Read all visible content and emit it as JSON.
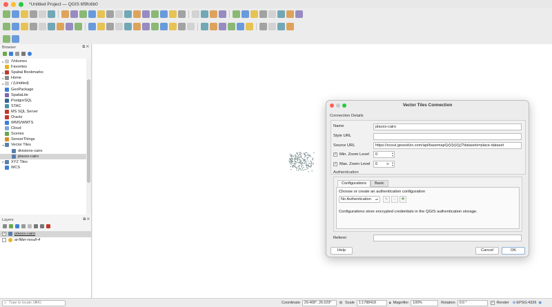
{
  "window": {
    "title": "*Untitled Project — QGIS 6f9fc6b0"
  },
  "toolbar_row1": [
    "new-project",
    "open-project",
    "save-project",
    "save-as",
    "print-layout",
    "layout-manager",
    "sep",
    "pan",
    "pan-to-selection",
    "zoom-in",
    "zoom-out",
    "zoom-full",
    "zoom-layer",
    "zoom-selection",
    "zoom-last",
    "zoom-next",
    "zoom-native",
    "new-map-view",
    "new-3d-view",
    "temporal",
    "refresh",
    "sep",
    "identify",
    "select",
    "deselect",
    "measure",
    "sep",
    "info",
    "attribute-table",
    "field-calc",
    "statistics",
    "toolbox",
    "show-tips",
    "annotation",
    "map-tips"
  ],
  "toolbar_row2": [
    "add-vector",
    "add-raster",
    "add-mesh",
    "add-csv",
    "add-spatialite",
    "add-postgis",
    "add-wms",
    "add-wfs",
    "add-vector-tile",
    "sep",
    "digitize",
    "edit",
    "save-edits",
    "add-feature",
    "move-feature",
    "vertex-tool",
    "delete",
    "cut",
    "copy",
    "paste",
    "undo",
    "redo",
    "sep",
    "label",
    "label-pin",
    "label-show",
    "label-move",
    "label-rotate",
    "label-change",
    "sep",
    "plugin-a",
    "plugin-b",
    "plugin-c",
    "python"
  ],
  "toolbar_row3": [
    "plugin-manager",
    "metasearch"
  ],
  "browser": {
    "title": "Browser",
    "items": [
      {
        "label": "/Volumes",
        "icon": "folder-icon",
        "arrow": "▸",
        "indent": 0
      },
      {
        "label": "Favorites",
        "icon": "star-icon",
        "arrow": "",
        "indent": 0
      },
      {
        "label": "Spatial Bookmarks",
        "icon": "bookmark-icon",
        "arrow": "▸",
        "indent": 0
      },
      {
        "label": "Home",
        "icon": "home-icon",
        "arrow": "▸",
        "indent": 0
      },
      {
        "label": "/ (Untitled)",
        "icon": "folder-icon",
        "arrow": "▸",
        "indent": 0
      },
      {
        "label": "GeoPackage",
        "icon": "geopackage-icon",
        "arrow": "",
        "indent": 0
      },
      {
        "label": "SpatiaLite",
        "icon": "spatialite-icon",
        "arrow": "",
        "indent": 0
      },
      {
        "label": "PostgreSQL",
        "icon": "postgresql-icon",
        "arrow": "",
        "indent": 0
      },
      {
        "label": "STAC",
        "icon": "stac-icon",
        "arrow": "",
        "indent": 0
      },
      {
        "label": "MS SQL Server",
        "icon": "mssql-icon",
        "arrow": "",
        "indent": 0
      },
      {
        "label": "Oracle",
        "icon": "oracle-icon",
        "arrow": "",
        "indent": 0
      },
      {
        "label": "WMS/WMTS",
        "icon": "globe-icon",
        "arrow": "",
        "indent": 0
      },
      {
        "label": "Cloud",
        "icon": "cloud-icon",
        "arrow": "",
        "indent": 0
      },
      {
        "label": "Scenes",
        "icon": "scenes-icon",
        "arrow": "",
        "indent": 0
      },
      {
        "label": "SensorThings",
        "icon": "sensor-icon",
        "arrow": "",
        "indent": 0
      },
      {
        "label": "Vector Tiles",
        "icon": "vector-tiles-icon",
        "arrow": "▾",
        "indent": 0
      },
      {
        "label": "divisions-cairo",
        "icon": "vector-tiles-icon",
        "arrow": "",
        "indent": 1
      },
      {
        "label": "places-cairo",
        "icon": "vector-tiles-icon",
        "arrow": "",
        "indent": 1,
        "selected": true
      },
      {
        "label": "XYZ Tiles",
        "icon": "xyz-icon",
        "arrow": "▸",
        "indent": 0
      },
      {
        "label": "WCS",
        "icon": "globe-icon",
        "arrow": "",
        "indent": 0
      }
    ]
  },
  "layers": {
    "title": "Layers",
    "items": [
      {
        "label": "places-cairo",
        "checked": true,
        "selected": true,
        "icon": "vector-tiles-icon"
      },
      {
        "label": "ai-filter-result-4",
        "checked": false,
        "selected": false,
        "icon": "point-layer-icon"
      }
    ]
  },
  "statusbar": {
    "locate_placeholder": "Type to locate (⌘K)",
    "coordinate_label": "Coordinate",
    "coordinate_value": "29.408°, 26.029°",
    "scale_label": "Scale",
    "scale_value": "1:1788418",
    "magnifier_label": "Magnifier",
    "magnifier_value": "100%",
    "rotation_label": "Rotation",
    "rotation_value": "0.0 °",
    "render_label": "Render",
    "crs_label": "EPSG:4326"
  },
  "dialog": {
    "title": "Vector Tiles Connection",
    "section_connection": "Connection Details",
    "name_label": "Name",
    "name_value": "places-cairo",
    "style_url_label": "Style URL",
    "style_url_value": "",
    "source_url_label": "Source URL",
    "source_url_value": "https://scout.geosolvix.com/api/basemap/{z}/{x}/{y}?datasets=place-dataset",
    "min_zoom_label": "Min. Zoom Level",
    "min_zoom_value": "0",
    "max_zoom_label": "Max. Zoom Level",
    "max_zoom_value": "6",
    "auth_label": "Authentication",
    "tab_configurations": "Configurations",
    "tab_basic": "Basic",
    "auth_hint": "Choose or create an authentication configuration",
    "auth_select_value": "No Authentication",
    "auth_note": "Configurations store encrypted credentials in the QGIS authentication storage.",
    "referer_label": "Referer",
    "referer_value": "",
    "help_button": "Help",
    "cancel_button": "Cancel",
    "ok_button": "OK"
  },
  "colors": {
    "accent_blue": "#3d7fd6",
    "qgis_green": "#6aa84f",
    "qgis_yellow": "#e6b422",
    "map_points": "#7a8c8c"
  }
}
